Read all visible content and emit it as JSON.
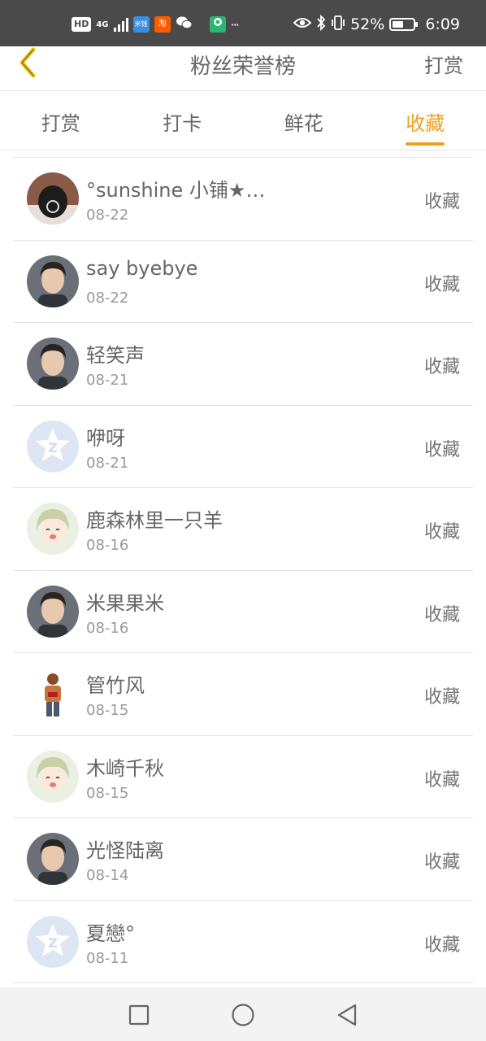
{
  "status_bar": {
    "hd": "HD",
    "network": "4G",
    "apps": [
      {
        "icon": "mi-app-icon",
        "label": "米钱",
        "color": "#3b8de0"
      },
      {
        "icon": "taobao-icon",
        "label": "淘",
        "color": "#ff5a00"
      }
    ],
    "more": "···",
    "battery_percent": "52%",
    "battery_level": 0.52,
    "time": "6:09"
  },
  "header": {
    "title": "粉丝荣誉榜",
    "action": "打赏"
  },
  "tabs": [
    {
      "label": "打赏",
      "active": false
    },
    {
      "label": "打卡",
      "active": false
    },
    {
      "label": "鲜花",
      "active": false
    },
    {
      "label": "收藏",
      "active": true
    }
  ],
  "accent_color": "#f0a020",
  "fans": [
    {
      "name": "°sunshine 小铺★…",
      "date": "08-22",
      "action": "收藏",
      "avatar": "dark-hood-avatar"
    },
    {
      "name": "say byebye",
      "date": "08-22",
      "action": "收藏",
      "avatar": "portrait-avatar"
    },
    {
      "name": "轻笑声",
      "date": "08-21",
      "action": "收藏",
      "avatar": "portrait-avatar"
    },
    {
      "name": "咿呀",
      "date": "08-21",
      "action": "收藏",
      "avatar": "default-avatar"
    },
    {
      "name": "鹿森林里一只羊",
      "date": "08-16",
      "action": "收藏",
      "avatar": "anime-avatar"
    },
    {
      "name": "米果果米",
      "date": "08-16",
      "action": "收藏",
      "avatar": "portrait-avatar"
    },
    {
      "name": "管竹风",
      "date": "08-15",
      "action": "收藏",
      "avatar": "figure-avatar"
    },
    {
      "name": "木崎千秋",
      "date": "08-15",
      "action": "收藏",
      "avatar": "anime-avatar"
    },
    {
      "name": "光怪陆离",
      "date": "08-14",
      "action": "收藏",
      "avatar": "portrait-avatar"
    },
    {
      "name": "夏戀°",
      "date": "08-11",
      "action": "收藏",
      "avatar": "default-avatar"
    }
  ]
}
